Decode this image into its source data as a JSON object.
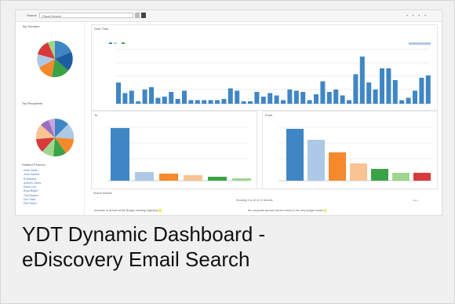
{
  "caption": {
    "line1": "YDT Dynamic Dashboard -",
    "line2": "eDiscovery Email Search"
  },
  "dashboard": {
    "topbar_label": "Search",
    "topbar_select": "Fiscal Search",
    "sidebar": {
      "pie1_title": "Top Senders",
      "pie2_title": "Top Recipients",
      "list_title": "Related Persons",
      "list_items": [
        "Keith Smith",
        "Jane Daniels",
        "B Williams",
        "Andrew Jones",
        "Karen Lee",
        "Ross Bright",
        "Tina Bowers",
        "Dev Patel",
        "Elle Parker"
      ]
    },
    "panels": {
      "top_title": "Over Time",
      "mid_left_title": "To",
      "mid_right_title": "From",
      "legend_right": "Sent/Received"
    },
    "bottom": {
      "title": "Search Results",
      "count_text": "Showing 1 to 10 of 12 records",
      "row1_left": "reminder to all from at the Budget meeting regarding",
      "row1_right": "the corporate account will be moved to the new budget review"
    },
    "colors": {
      "bar_blue": "#3f86c4",
      "bar_light_blue": "#aec9e6",
      "bar_orange": "#f5892b",
      "bar_peach": "#f9c394",
      "bar_green": "#3aa346",
      "bar_light_green": "#9fd68f",
      "bar_red": "#d9393a"
    }
  }
}
